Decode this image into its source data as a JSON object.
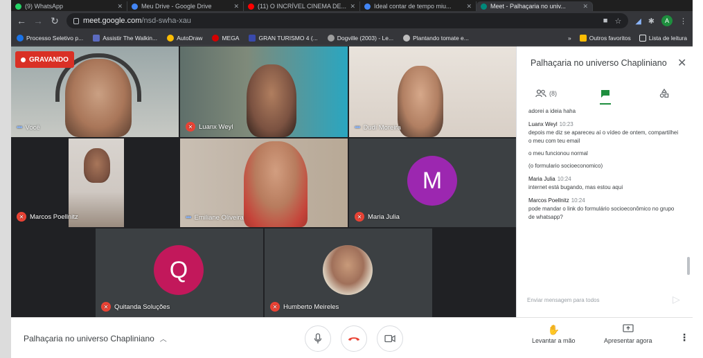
{
  "browser": {
    "tabs": [
      {
        "label": "(9) WhatsApp",
        "color": "#25d366",
        "active": false
      },
      {
        "label": "Meu Drive - Google Drive",
        "color": "#4285f4",
        "active": false
      },
      {
        "label": "(11) O INCRÍVEL CINEMA DE...",
        "color": "#ff0000",
        "active": false
      },
      {
        "label": "Ideal contar de tempo miu...",
        "color": "#4285f4",
        "active": false
      },
      {
        "label": "Meet - Palhaçaria no univ...",
        "color": "#00897b",
        "active": true
      }
    ],
    "url_host": "meet.google.com",
    "url_path": "/nsd-swha-xau",
    "profile_letter": "A",
    "bookmarks": [
      {
        "label": "Processo Seletivo p...",
        "color": "#1a73e8"
      },
      {
        "label": "Assistir The Walkin...",
        "color": "#5c6bc0"
      },
      {
        "label": "AutoDraw",
        "color": "#fbbc04"
      },
      {
        "label": "MEGA",
        "color": "#d50000"
      },
      {
        "label": "GRAN TURISMO 4 (...",
        "color": "#3949ab"
      },
      {
        "label": "Dogville (2003) - Le...",
        "color": "#9e9e9e"
      },
      {
        "label": "Plantando tomate e...",
        "color": "#bdbdbd"
      }
    ],
    "bookmarks_more": "»",
    "other_favorites": "Outros favoritos",
    "reading_list": "Lista de leitura"
  },
  "meet": {
    "recording_label": "GRAVANDO",
    "participants": [
      {
        "name": "Você",
        "muted": false,
        "speaking": true
      },
      {
        "name": "Luanx Weyl",
        "muted": true,
        "speaking": false
      },
      {
        "name": "Dudi Moreira",
        "muted": false,
        "speaking": true
      },
      {
        "name": "Marcos Poellnitz",
        "muted": true,
        "speaking": false
      },
      {
        "name": "Emiliane Oliveira",
        "muted": false,
        "speaking": true
      },
      {
        "name": "Maria Julia",
        "muted": true,
        "speaking": false,
        "avatar_letter": "M",
        "avatar_color": "#9c27b0"
      },
      {
        "name": "Quitanda Soluções",
        "muted": true,
        "speaking": false,
        "avatar_letter": "Q",
        "avatar_color": "#c2185b"
      },
      {
        "name": "Humberto Meireles",
        "muted": true,
        "speaking": false
      }
    ]
  },
  "panel": {
    "title": "Palhaçaria no universo Chapliniano",
    "people_count": "(8)",
    "messages": [
      {
        "sender": "",
        "time": "",
        "lines": [
          "adorei a ideia haha"
        ]
      },
      {
        "sender": "Luanx Weyl",
        "time": "10:23",
        "lines": [
          "depois me diz se apareceu aí o vídeo de ontem, compartilhei o meu com teu email",
          "o meu funcionou normal",
          "(o formulario socioeconomico)"
        ]
      },
      {
        "sender": "Maria Julia",
        "time": "10:24",
        "lines": [
          "internet está bugando, mas estou aqui"
        ]
      },
      {
        "sender": "Marcos Poellnitz",
        "time": "10:24",
        "lines": [
          "pode mandar o link do formulário socioeconômico no grupo de whatsapp?"
        ]
      }
    ],
    "input_placeholder": "Enviar mensagem para todos"
  },
  "bottom": {
    "meeting_title": "Palhaçaria no universo Chapliniano",
    "raise_hand": "Levantar a mão",
    "present_now": "Apresentar agora"
  }
}
